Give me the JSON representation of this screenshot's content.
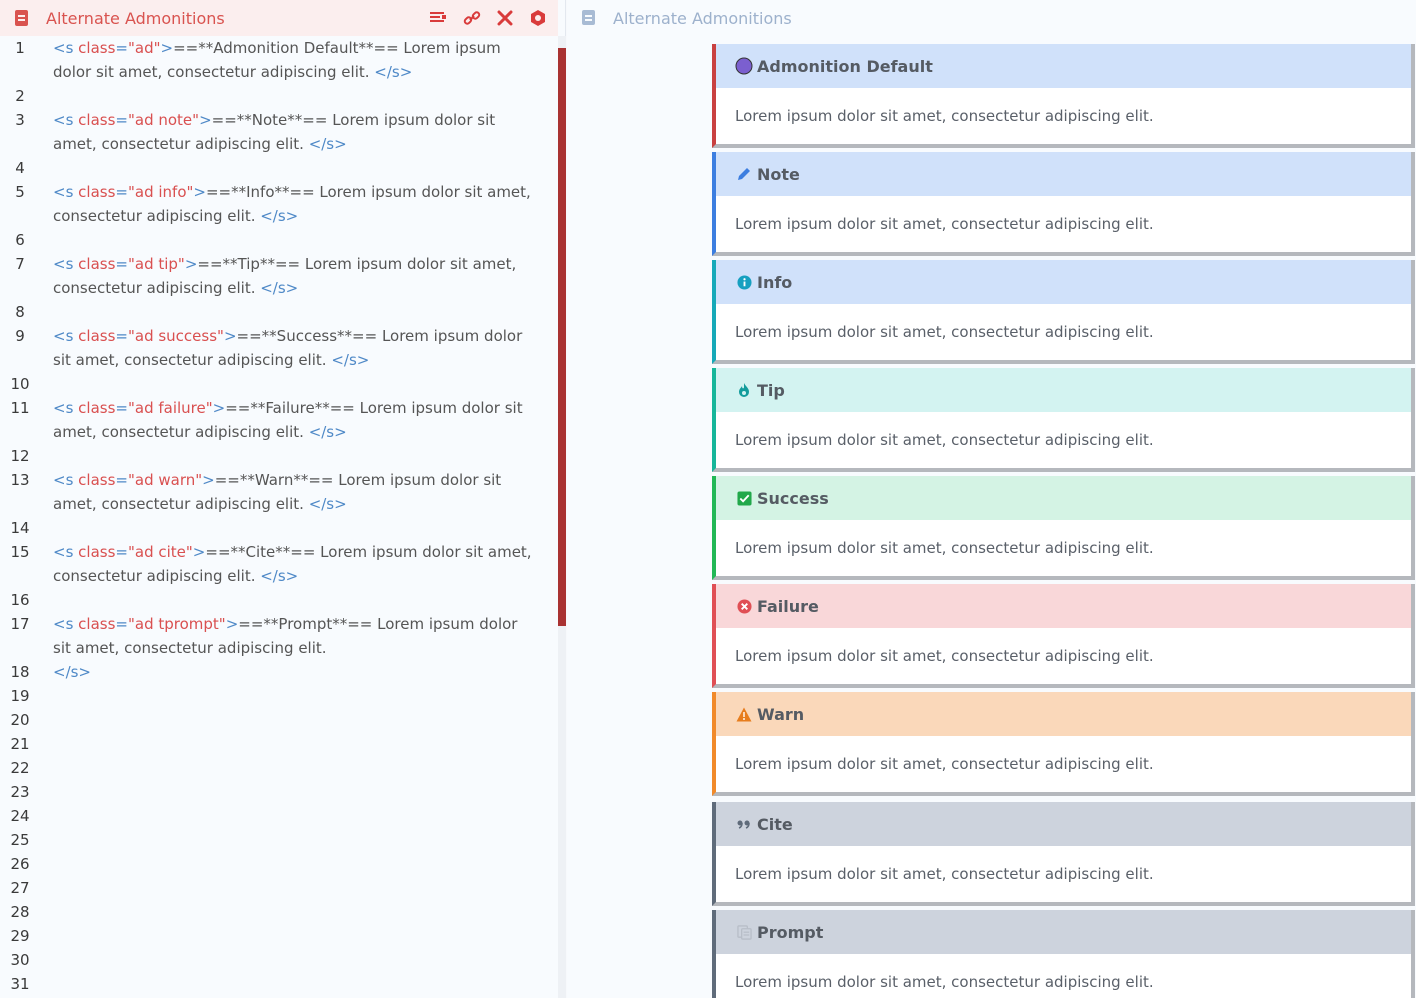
{
  "editor": {
    "title": "Alternate Admonitions",
    "lines": [
      {
        "n": "1",
        "parts": [
          {
            "c": "tag",
            "t": "<s "
          },
          {
            "c": "attr",
            "t": "class"
          },
          {
            "c": "tag",
            "t": "="
          },
          {
            "c": "attr",
            "t": "\"ad\""
          },
          {
            "c": "tag",
            "t": ">"
          },
          {
            "c": "op",
            "t": "==**Admonition Default**==  Lorem ipsum dolor sit amet, consectetur adipiscing elit. "
          },
          {
            "c": "tag",
            "t": "</s>"
          }
        ]
      },
      {
        "n": "2",
        "parts": []
      },
      {
        "n": "3",
        "parts": [
          {
            "c": "tag",
            "t": "<s "
          },
          {
            "c": "attr",
            "t": "class"
          },
          {
            "c": "tag",
            "t": "="
          },
          {
            "c": "attr",
            "t": "\"ad note\""
          },
          {
            "c": "tag",
            "t": ">"
          },
          {
            "c": "op",
            "t": "==**Note**==  Lorem ipsum dolor sit amet, consectetur adipiscing elit. "
          },
          {
            "c": "tag",
            "t": "</s>"
          }
        ]
      },
      {
        "n": "4",
        "parts": []
      },
      {
        "n": "5",
        "parts": [
          {
            "c": "tag",
            "t": "<s "
          },
          {
            "c": "attr",
            "t": "class"
          },
          {
            "c": "tag",
            "t": "="
          },
          {
            "c": "attr",
            "t": "\"ad info\""
          },
          {
            "c": "tag",
            "t": ">"
          },
          {
            "c": "op",
            "t": "==**Info**==  Lorem ipsum dolor sit amet, consectetur adipiscing elit. "
          },
          {
            "c": "tag",
            "t": "</s>"
          }
        ]
      },
      {
        "n": "6",
        "parts": []
      },
      {
        "n": "7",
        "parts": [
          {
            "c": "tag",
            "t": "<s "
          },
          {
            "c": "attr",
            "t": "class"
          },
          {
            "c": "tag",
            "t": "="
          },
          {
            "c": "attr",
            "t": "\"ad tip\""
          },
          {
            "c": "tag",
            "t": ">"
          },
          {
            "c": "op",
            "t": "==**Tip**==  Lorem ipsum dolor sit amet, consectetur adipiscing elit. "
          },
          {
            "c": "tag",
            "t": "</s>"
          }
        ]
      },
      {
        "n": "8",
        "parts": []
      },
      {
        "n": "9",
        "parts": [
          {
            "c": "tag",
            "t": "<s "
          },
          {
            "c": "attr",
            "t": "class"
          },
          {
            "c": "tag",
            "t": "="
          },
          {
            "c": "attr",
            "t": "\"ad success\""
          },
          {
            "c": "tag",
            "t": ">"
          },
          {
            "c": "op",
            "t": "==**Success**==  Lorem ipsum dolor sit amet, consectetur adipiscing elit. "
          },
          {
            "c": "tag",
            "t": "</s>"
          }
        ]
      },
      {
        "n": "10",
        "parts": []
      },
      {
        "n": "11",
        "parts": [
          {
            "c": "tag",
            "t": "<s "
          },
          {
            "c": "attr",
            "t": "class"
          },
          {
            "c": "tag",
            "t": "="
          },
          {
            "c": "attr",
            "t": "\"ad failure\""
          },
          {
            "c": "tag",
            "t": ">"
          },
          {
            "c": "op",
            "t": "==**Failure**==  Lorem ipsum dolor sit amet, consectetur adipiscing elit. "
          },
          {
            "c": "tag",
            "t": "</s>"
          }
        ]
      },
      {
        "n": "12",
        "parts": []
      },
      {
        "n": "13",
        "parts": [
          {
            "c": "tag",
            "t": "<s "
          },
          {
            "c": "attr",
            "t": "class"
          },
          {
            "c": "tag",
            "t": "="
          },
          {
            "c": "attr",
            "t": "\"ad warn\""
          },
          {
            "c": "tag",
            "t": ">"
          },
          {
            "c": "op",
            "t": "==**Warn**==  Lorem ipsum dolor sit amet, consectetur adipiscing elit. "
          },
          {
            "c": "tag",
            "t": "</s>"
          }
        ]
      },
      {
        "n": "14",
        "parts": []
      },
      {
        "n": "15",
        "parts": [
          {
            "c": "tag",
            "t": "<s "
          },
          {
            "c": "attr",
            "t": "class"
          },
          {
            "c": "tag",
            "t": "="
          },
          {
            "c": "attr",
            "t": "\"ad cite\""
          },
          {
            "c": "tag",
            "t": ">"
          },
          {
            "c": "op",
            "t": "==**Cite**==  Lorem ipsum dolor sit amet, consectetur adipiscing elit. "
          },
          {
            "c": "tag",
            "t": "</s>"
          }
        ]
      },
      {
        "n": "16",
        "parts": []
      },
      {
        "n": "17",
        "parts": [
          {
            "c": "tag",
            "t": "<s "
          },
          {
            "c": "attr",
            "t": "class"
          },
          {
            "c": "tag",
            "t": "="
          },
          {
            "c": "attr",
            "t": "\"ad tprompt\""
          },
          {
            "c": "tag",
            "t": ">"
          },
          {
            "c": "op",
            "t": "==**Prompt**==  Lorem ipsum dolor sit amet, consectetur adipiscing elit."
          }
        ]
      },
      {
        "n": "18",
        "parts": [
          {
            "c": "tag",
            "t": "</s>"
          }
        ]
      },
      {
        "n": "19",
        "parts": []
      },
      {
        "n": "20",
        "parts": []
      },
      {
        "n": "21",
        "parts": []
      },
      {
        "n": "22",
        "parts": []
      },
      {
        "n": "23",
        "parts": []
      },
      {
        "n": "24",
        "parts": []
      },
      {
        "n": "25",
        "parts": []
      },
      {
        "n": "26",
        "parts": []
      },
      {
        "n": "27",
        "parts": []
      },
      {
        "n": "28",
        "parts": []
      },
      {
        "n": "29",
        "parts": []
      },
      {
        "n": "30",
        "parts": []
      },
      {
        "n": "31",
        "parts": []
      }
    ]
  },
  "preview": {
    "title": "Alternate Admonitions",
    "admonitions": [
      {
        "key": "default",
        "title": "Admonition Default",
        "body": "Lorem ipsum dolor sit amet, consectetur adipiscing elit.",
        "icon": "circle-icon",
        "accent": "#c94040",
        "head_bg": "#d0e1fa",
        "icon_color": "#7b5fcf"
      },
      {
        "key": "note",
        "title": "Note",
        "body": "Lorem ipsum dolor sit amet, consectetur adipiscing elit.",
        "icon": "pencil-icon",
        "accent": "#3c7ee0",
        "head_bg": "#d0e1fa",
        "icon_color": "#3c7ee0"
      },
      {
        "key": "info",
        "title": "Info",
        "body": "Lorem ipsum dolor sit amet, consectetur adipiscing elit.",
        "icon": "info-icon",
        "accent": "#16a9b8",
        "head_bg": "#d0e1fa",
        "icon_color": "#16a0c0"
      },
      {
        "key": "tip",
        "title": "Tip",
        "body": "Lorem ipsum dolor sit amet, consectetur adipiscing elit.",
        "icon": "flame-icon",
        "accent": "#16b69a",
        "head_bg": "#d3f3f1",
        "icon_color": "#139c9c"
      },
      {
        "key": "success",
        "title": "Success",
        "body": "Lorem ipsum dolor sit amet, consectetur adipiscing elit.",
        "icon": "check-square-icon",
        "accent": "#22b856",
        "head_bg": "#d4f3e4",
        "icon_color": "#21a84a"
      },
      {
        "key": "failure",
        "title": "Failure",
        "body": "Lorem ipsum dolor sit amet, consectetur adipiscing elit.",
        "icon": "x-circle-icon",
        "accent": "#e04f55",
        "head_bg": "#f9d7d9",
        "icon_color": "#e04f55"
      },
      {
        "key": "warn",
        "title": "Warn",
        "body": "Lorem ipsum dolor sit amet, consectetur adipiscing elit.",
        "icon": "warning-icon",
        "accent": "#f18a2a",
        "head_bg": "#fad8ba",
        "icon_color": "#e77d1e"
      },
      {
        "key": "cite",
        "title": "Cite",
        "body": "Lorem ipsum dolor sit amet, consectetur adipiscing elit.",
        "icon": "quote-icon",
        "accent": "#5f6b7a",
        "head_bg": "#cdd3dd",
        "icon_color": "#5f6b7a"
      },
      {
        "key": "prompt",
        "title": "Prompt",
        "body": "Lorem ipsum dolor sit amet, consectetur adipiscing elit.",
        "icon": "prompt-icon",
        "accent": "#5f6b7a",
        "head_bg": "#cdd3dd",
        "icon_color": "#b8bec8"
      }
    ]
  }
}
